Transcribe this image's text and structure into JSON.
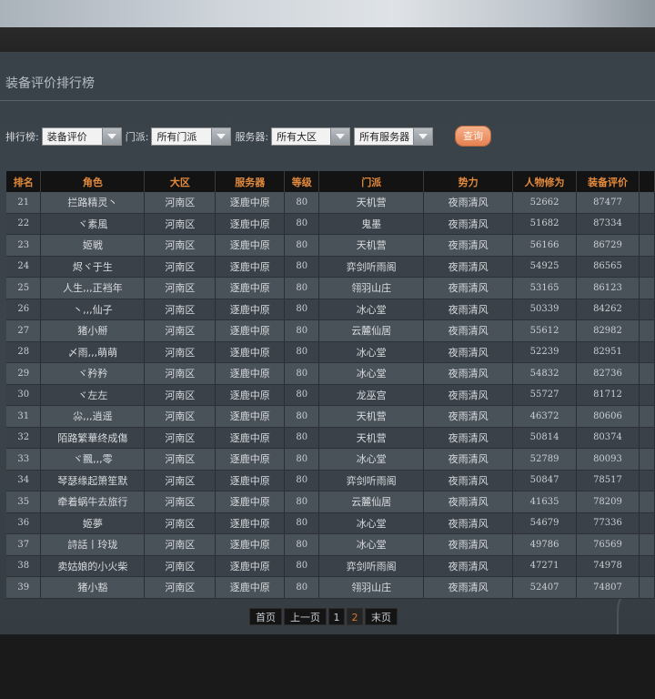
{
  "page": {
    "title": "装备评价排行榜"
  },
  "filters": {
    "board_label": "排行榜:",
    "board_value": "装备评价",
    "sect_label": "门派:",
    "sect_value": "所有门派",
    "server_label": "服务器:",
    "region_value": "所有大区",
    "server_value": "所有服务器",
    "query_label": "查询"
  },
  "table": {
    "headers": [
      "排名",
      "角色",
      "大区",
      "服务器",
      "等级",
      "门派",
      "势力",
      "人物修为",
      "装备评价"
    ],
    "rows": [
      [
        "21",
        "拦路精灵丶",
        "河南区",
        "逐鹿中原",
        "80",
        "天机营",
        "夜雨清风",
        "52662",
        "87477"
      ],
      [
        "22",
        "ヾ素風",
        "河南区",
        "逐鹿中原",
        "80",
        "鬼墨",
        "夜雨清风",
        "51682",
        "87334"
      ],
      [
        "23",
        "姬戦",
        "河南区",
        "逐鹿中原",
        "80",
        "天机营",
        "夜雨清风",
        "56166",
        "86729"
      ],
      [
        "24",
        "烬ヾ于生",
        "河南区",
        "逐鹿中原",
        "80",
        "弈剑听雨阁",
        "夜雨清风",
        "54925",
        "86565"
      ],
      [
        "25",
        "人生,,,正裆年",
        "河南区",
        "逐鹿中原",
        "80",
        "翎羽山庄",
        "夜雨清风",
        "53165",
        "86123"
      ],
      [
        "26",
        "丶,,,仙子",
        "河南区",
        "逐鹿中原",
        "80",
        "冰心堂",
        "夜雨清风",
        "50339",
        "84262"
      ],
      [
        "27",
        "猪小掰",
        "河南区",
        "逐鹿中原",
        "80",
        "云麓仙居",
        "夜雨清风",
        "55612",
        "82982"
      ],
      [
        "28",
        "〆雨,,,萌萌",
        "河南区",
        "逐鹿中原",
        "80",
        "冰心堂",
        "夜雨清风",
        "52239",
        "82951"
      ],
      [
        "29",
        "ヾ矜矜",
        "河南区",
        "逐鹿中原",
        "80",
        "冰心堂",
        "夜雨清风",
        "54832",
        "82736"
      ],
      [
        "30",
        "ヾ左左",
        "河南区",
        "逐鹿中原",
        "80",
        "龙巫宫",
        "夜雨清风",
        "55727",
        "81712"
      ],
      [
        "31",
        "尛,,,逍遥",
        "河南区",
        "逐鹿中原",
        "80",
        "天机营",
        "夜雨清风",
        "46372",
        "80606"
      ],
      [
        "32",
        "陌路繁華终成傷",
        "河南区",
        "逐鹿中原",
        "80",
        "天机营",
        "夜雨清风",
        "50814",
        "80374"
      ],
      [
        "33",
        "ヾ飄,,,零",
        "河南区",
        "逐鹿中原",
        "80",
        "冰心堂",
        "夜雨清风",
        "52789",
        "80093"
      ],
      [
        "34",
        "琴瑟缘起箫笙默",
        "河南区",
        "逐鹿中原",
        "80",
        "弈剑听雨阁",
        "夜雨清风",
        "50847",
        "78517"
      ],
      [
        "35",
        "牵着蜗牛去旅行",
        "河南区",
        "逐鹿中原",
        "80",
        "云麓仙居",
        "夜雨清风",
        "41635",
        "78209"
      ],
      [
        "36",
        "姬夢",
        "河南区",
        "逐鹿中原",
        "80",
        "冰心堂",
        "夜雨清风",
        "54679",
        "77336"
      ],
      [
        "37",
        "詩話丨玲珑",
        "河南区",
        "逐鹿中原",
        "80",
        "冰心堂",
        "夜雨清风",
        "49786",
        "76569"
      ],
      [
        "38",
        "卖姑娘的小火柴",
        "河南区",
        "逐鹿中原",
        "80",
        "弈剑听雨阁",
        "夜雨清风",
        "47271",
        "74978"
      ],
      [
        "39",
        "猪小豁",
        "河南区",
        "逐鹿中原",
        "80",
        "翎羽山庄",
        "夜雨清风",
        "52407",
        "74807"
      ]
    ]
  },
  "pager": {
    "first": "首页",
    "prev": "上一页",
    "page1": "1",
    "page2": "2",
    "last": "末页"
  }
}
